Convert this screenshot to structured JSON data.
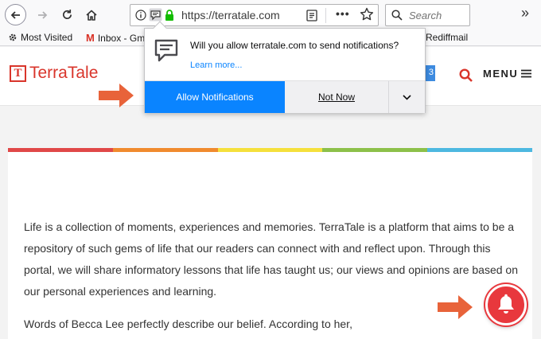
{
  "browser": {
    "url": "https://terratale.com",
    "search_placeholder": "Search",
    "more_actions": "•••",
    "overflow": "»"
  },
  "bookmarks": [
    {
      "label": "Most Visited"
    },
    {
      "label": "Inbox - Gm"
    },
    {
      "label": "Rediffmail"
    }
  ],
  "site": {
    "logo_letter": "T",
    "logo_name": "TerraTale",
    "partial_badge": "3",
    "menu_label": "MENU"
  },
  "popup": {
    "message": "Will you allow terratale.com to send notifications?",
    "learn_more": "Learn more...",
    "allow_label": "Allow Notifications",
    "not_now_label": "Not Now"
  },
  "stripe_colors": [
    "#e04848",
    "#f08a2e",
    "#f5e03c",
    "#8cc04a",
    "#4db8e0"
  ],
  "content": {
    "paragraph1": "Life is a collection of moments, experiences and memories. TerraTale is a platform that aims to be a repository of such gems of life that our readers can connect with and reflect upon. Through this portal, we will share informatory lessons that life has taught us; our views and opinions are based on our personal experiences and learning.",
    "paragraph2": "Words of Becca Lee perfectly describe our belief. According to her,"
  },
  "colors": {
    "brand_red": "#d9352b",
    "allow_blue": "#0a84ff",
    "bell_red": "#e8383d",
    "arrow_orange": "#e8633a"
  }
}
